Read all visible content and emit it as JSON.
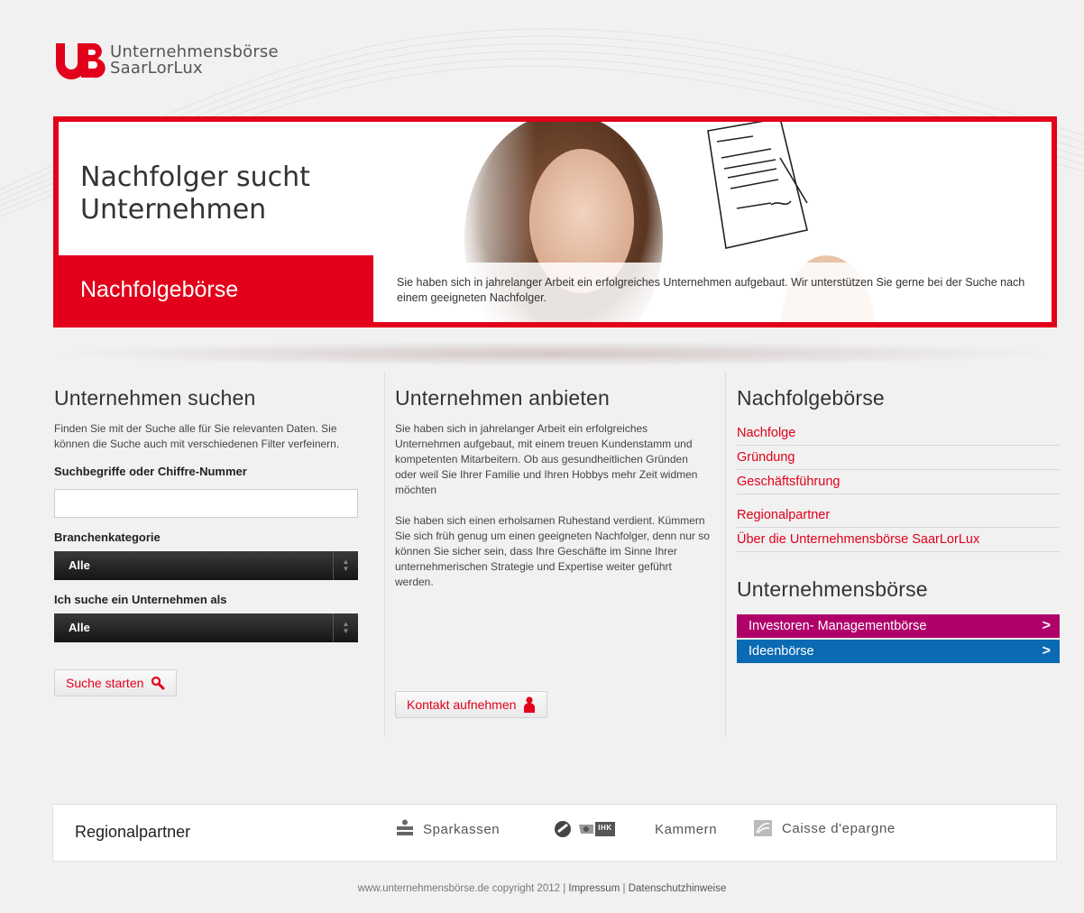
{
  "logo": {
    "mark": "UB",
    "line1": "Unternehmensbörse",
    "line2": "SaarLorLux",
    "color": "#e2001a"
  },
  "hero": {
    "title_line1": "Nachfolger sucht",
    "title_line2": "Unternehmen",
    "badge": "Nachfolgebörse",
    "text": "Sie haben sich in jahrelanger Arbeit ein erfolgreiches Unternehmen aufgebaut. Wir unterstützen Sie gerne bei der Suche nach einem geeigneten Nachfolger."
  },
  "search": {
    "title": "Unternehmen suchen",
    "description": "Finden Sie mit der Suche alle für Sie relevanten Daten. Sie können die Suche auch mit verschiedenen Filter verfeinern.",
    "keyword_label": "Suchbegriffe oder Chiffre-Nummer",
    "keyword_value": "",
    "branch_label": "Branchenkategorie",
    "branch_value": "Alle",
    "role_label": "Ich suche ein Unternehmen als",
    "role_value": "Alle",
    "button": "Suche starten"
  },
  "offer": {
    "title": "Unternehmen anbieten",
    "para1": "Sie haben sich in jahrelanger Arbeit ein erfolgreiches Unternehmen aufgebaut, mit einem treuen Kundenstamm und kompetenten Mitarbeitern. Ob aus gesundheitlichen Gründen oder weil Sie Ihrer Familie und Ihren Hobbys mehr Zeit widmen möchten",
    "para2": "Sie haben sich einen erholsamen Ruhestand verdient. Kümmern Sie sich früh genug um einen geeigneten Nachfolger, denn nur so können Sie sicher sein, dass Ihre Geschäfte im Sinne Ihrer unternehmerischen Strategie und Expertise weiter geführt werden.",
    "button": "Kontakt aufnehmen"
  },
  "nav": {
    "title": "Nachfolgebörse",
    "links": [
      "Nachfolge",
      "Gründung",
      "Geschäftsführung",
      "Regionalpartner",
      "Über die Unternehmensbörse SaarLorLux"
    ],
    "section2_title": "Unternehmensbörse",
    "bar1": "Investoren- Managementbörse",
    "bar1_color": "#b0006a",
    "bar2": "Ideenbörse",
    "bar2_color": "#0a6ab3",
    "chevron": ">"
  },
  "partners": {
    "title": "Regionalpartner",
    "sparkassen": "Sparkassen",
    "ihk_badge": "IHK",
    "kammern": "Kammern",
    "caisse": "Caisse d'epargne"
  },
  "footer": {
    "copyright": "www.unternehmensbörse.de copyright 2012 |",
    "impressum": "Impressum",
    "sep": "|",
    "datenschutz": "Datenschutzhinweise"
  }
}
